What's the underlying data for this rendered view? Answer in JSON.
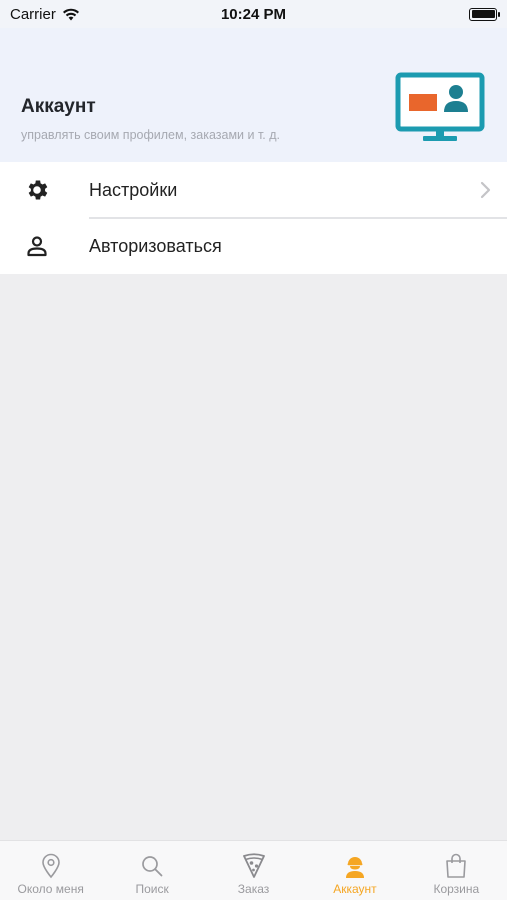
{
  "status_bar": {
    "carrier": "Carrier",
    "time": "10:24 PM"
  },
  "header": {
    "title": "Аккаунт",
    "subtitle": "управлять своим профилем, заказами и т. д.",
    "illustration": "monitor-profile-illustration"
  },
  "menu": {
    "items": [
      {
        "label": "Настройки",
        "icon": "gear-icon",
        "has_chevron": true
      },
      {
        "label": "Авторизоваться",
        "icon": "user-icon",
        "has_chevron": false
      }
    ]
  },
  "tab_bar": {
    "active_index": 3,
    "active_color": "#f5a623",
    "inactive_color": "#9a9a9e",
    "tabs": [
      {
        "label": "Около меня",
        "icon": "location-pin-icon"
      },
      {
        "label": "Поиск",
        "icon": "search-icon"
      },
      {
        "label": "Заказ",
        "icon": "pizza-slice-icon"
      },
      {
        "label": "Аккаунт",
        "icon": "account-icon"
      },
      {
        "label": "Корзина",
        "icon": "shopping-bag-icon"
      }
    ]
  }
}
